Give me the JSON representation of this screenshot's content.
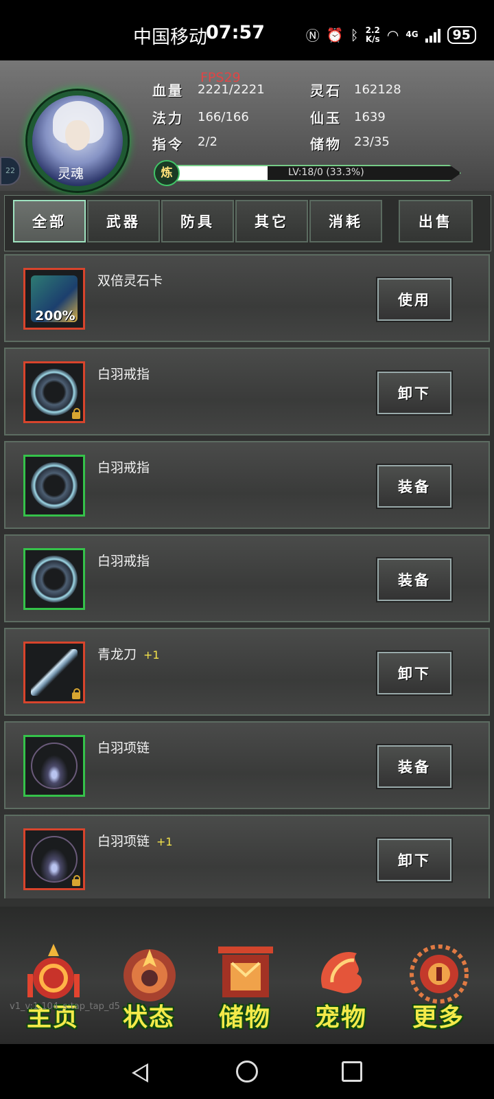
{
  "status_bar": {
    "carrier": "中国移动",
    "time": "07:57",
    "net_speed_value": "2.2",
    "net_speed_unit": "K/s",
    "network_type": "4G",
    "battery": "95"
  },
  "header": {
    "fps": "FPS29",
    "character_label": "灵魂",
    "stats": {
      "hp_label": "血量",
      "hp_value": "2221/2221",
      "mp_label": "法力",
      "mp_value": "166/166",
      "cmd_label": "指令",
      "cmd_value": "2/2",
      "spirit_stone_label": "灵石",
      "spirit_stone_value": "162128",
      "jade_label": "仙玉",
      "jade_value": "1639",
      "storage_label": "储物",
      "storage_value": "23/35"
    },
    "xp": {
      "badge": "炼",
      "text": "LV:18/0 (33.3%)",
      "progress_percent": 33.3
    }
  },
  "tabs": {
    "all": "全部",
    "weapon": "武器",
    "armor": "防具",
    "other": "其它",
    "consumable": "消耗",
    "sell": "出售"
  },
  "items": [
    {
      "name": "双倍灵石卡",
      "plus": "",
      "action": "使用",
      "badge_text": "200%"
    },
    {
      "name": "白羽戒指",
      "plus": "",
      "action": "卸下"
    },
    {
      "name": "白羽戒指",
      "plus": "",
      "action": "装备"
    },
    {
      "name": "白羽戒指",
      "plus": "",
      "action": "装备"
    },
    {
      "name": "青龙刀",
      "plus": "+1",
      "action": "卸下"
    },
    {
      "name": "白羽项链",
      "plus": "",
      "action": "装备"
    },
    {
      "name": "白羽项链",
      "plus": "+1",
      "action": "卸下"
    }
  ],
  "bottom_nav": {
    "home": "主页",
    "status": "状态",
    "storage": "储物",
    "pet": "宠物",
    "more": "更多"
  },
  "version_text": "v1_v:1.104_s:tap_tap_d5",
  "colors": {
    "accent_green": "#35c24a",
    "rarity_red": "#d8442c",
    "nav_label": "#f4ea4a",
    "fps_red": "#e04545"
  }
}
